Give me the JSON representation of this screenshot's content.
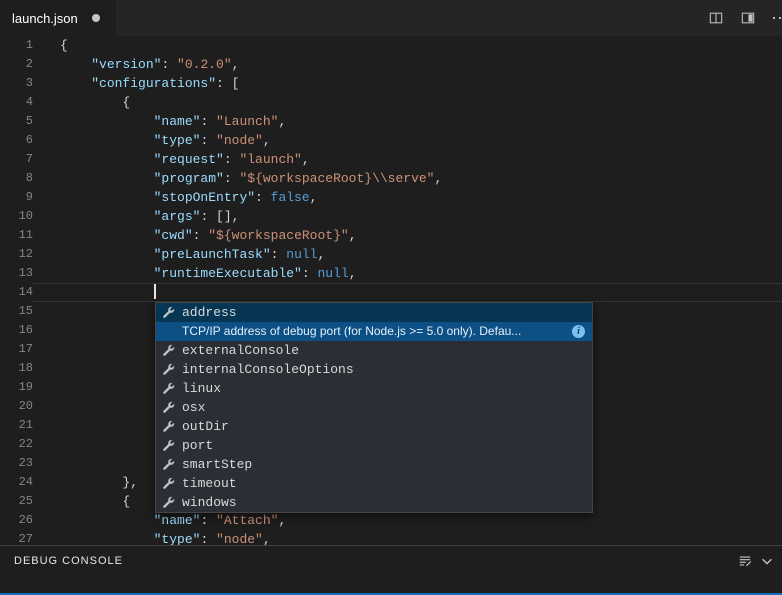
{
  "tab": {
    "title": "launch.json",
    "modified": true
  },
  "editor_actions": {
    "icons": [
      "split-editor-icon",
      "toggle-layout-icon",
      "more-actions-icon"
    ],
    "more_label": "⋯"
  },
  "colors": {
    "editor_bg": "#1e1e1e",
    "tabbar_bg": "#252526",
    "key": "#9cdcfe",
    "string": "#ce9178",
    "keyword": "#569cd6",
    "punct": "#d4d4d4",
    "line_number": "#858585",
    "suggest_bg": "#2b2f35",
    "suggest_selected_bg": "#073655",
    "suggest_docs_bg": "#0d5086",
    "accent": "#0e70c0"
  },
  "editor": {
    "lines": [
      {
        "num": 1,
        "tokens": [
          {
            "c": "p",
            "v": "{"
          }
        ]
      },
      {
        "num": 2,
        "tokens": [
          {
            "c": "p",
            "v": "    "
          },
          {
            "c": "k",
            "v": "\"version\""
          },
          {
            "c": "p",
            "v": ": "
          },
          {
            "c": "s",
            "v": "\"0.2.0\""
          },
          {
            "c": "p",
            "v": ","
          }
        ]
      },
      {
        "num": 3,
        "tokens": [
          {
            "c": "p",
            "v": "    "
          },
          {
            "c": "k",
            "v": "\"configurations\""
          },
          {
            "c": "p",
            "v": ": ["
          }
        ]
      },
      {
        "num": 4,
        "tokens": [
          {
            "c": "p",
            "v": "        {"
          }
        ]
      },
      {
        "num": 5,
        "tokens": [
          {
            "c": "p",
            "v": "            "
          },
          {
            "c": "k",
            "v": "\"name\""
          },
          {
            "c": "p",
            "v": ": "
          },
          {
            "c": "s",
            "v": "\"Launch\""
          },
          {
            "c": "p",
            "v": ","
          }
        ]
      },
      {
        "num": 6,
        "tokens": [
          {
            "c": "p",
            "v": "            "
          },
          {
            "c": "k",
            "v": "\"type\""
          },
          {
            "c": "p",
            "v": ": "
          },
          {
            "c": "s",
            "v": "\"node\""
          },
          {
            "c": "p",
            "v": ","
          }
        ]
      },
      {
        "num": 7,
        "tokens": [
          {
            "c": "p",
            "v": "            "
          },
          {
            "c": "k",
            "v": "\"request\""
          },
          {
            "c": "p",
            "v": ": "
          },
          {
            "c": "s",
            "v": "\"launch\""
          },
          {
            "c": "p",
            "v": ","
          }
        ]
      },
      {
        "num": 8,
        "tokens": [
          {
            "c": "p",
            "v": "            "
          },
          {
            "c": "k",
            "v": "\"program\""
          },
          {
            "c": "p",
            "v": ": "
          },
          {
            "c": "s",
            "v": "\"${workspaceRoot}\\\\serve\""
          },
          {
            "c": "p",
            "v": ","
          }
        ]
      },
      {
        "num": 9,
        "tokens": [
          {
            "c": "p",
            "v": "            "
          },
          {
            "c": "k",
            "v": "\"stopOnEntry\""
          },
          {
            "c": "p",
            "v": ": "
          },
          {
            "c": "b",
            "v": "false"
          },
          {
            "c": "p",
            "v": ","
          }
        ]
      },
      {
        "num": 10,
        "tokens": [
          {
            "c": "p",
            "v": "            "
          },
          {
            "c": "k",
            "v": "\"args\""
          },
          {
            "c": "p",
            "v": ": [],"
          }
        ]
      },
      {
        "num": 11,
        "tokens": [
          {
            "c": "p",
            "v": "            "
          },
          {
            "c": "k",
            "v": "\"cwd\""
          },
          {
            "c": "p",
            "v": ": "
          },
          {
            "c": "s",
            "v": "\"${workspaceRoot}\""
          },
          {
            "c": "p",
            "v": ","
          }
        ]
      },
      {
        "num": 12,
        "tokens": [
          {
            "c": "p",
            "v": "            "
          },
          {
            "c": "k",
            "v": "\"preLaunchTask\""
          },
          {
            "c": "p",
            "v": ": "
          },
          {
            "c": "b",
            "v": "null"
          },
          {
            "c": "p",
            "v": ","
          }
        ]
      },
      {
        "num": 13,
        "tokens": [
          {
            "c": "p",
            "v": "            "
          },
          {
            "c": "k",
            "v": "\"runtimeExecutable\""
          },
          {
            "c": "p",
            "v": ": "
          },
          {
            "c": "b",
            "v": "null"
          },
          {
            "c": "p",
            "v": ","
          }
        ]
      },
      {
        "num": 14,
        "current": true,
        "cursor": true,
        "tokens": [
          {
            "c": "p",
            "v": "            "
          }
        ]
      },
      {
        "num": 15,
        "tokens": []
      },
      {
        "num": 16,
        "tokens": []
      },
      {
        "num": 17,
        "tokens": []
      },
      {
        "num": 18,
        "tokens": []
      },
      {
        "num": 19,
        "tokens": []
      },
      {
        "num": 20,
        "tokens": []
      },
      {
        "num": 21,
        "tokens": []
      },
      {
        "num": 22,
        "tokens": []
      },
      {
        "num": 23,
        "tokens": []
      },
      {
        "num": 24,
        "tokens": [
          {
            "c": "p",
            "v": "        },"
          }
        ]
      },
      {
        "num": 25,
        "tokens": [
          {
            "c": "p",
            "v": "        {"
          }
        ]
      },
      {
        "num": 26,
        "tokens": [
          {
            "c": "p",
            "v": "            "
          },
          {
            "c": "k",
            "v": "\"name\""
          },
          {
            "c": "p",
            "v": ": "
          },
          {
            "c": "s",
            "v": "\"Attach\""
          },
          {
            "c": "p",
            "v": ","
          }
        ]
      },
      {
        "num": 27,
        "tokens": [
          {
            "c": "p",
            "v": "            "
          },
          {
            "c": "k",
            "v": "\"type\""
          },
          {
            "c": "p",
            "v": ": "
          },
          {
            "c": "s",
            "v": "\"node\""
          },
          {
            "c": "p",
            "v": ","
          }
        ]
      }
    ]
  },
  "suggest": {
    "kind_icon": "wrench-icon",
    "docs": "TCP/IP address of debug port (for Node.js >= 5.0 only). Defau...",
    "docs_info_icon": "info-icon",
    "items": [
      {
        "label": "address",
        "selected": true
      },
      {
        "label": "externalConsole"
      },
      {
        "label": "internalConsoleOptions"
      },
      {
        "label": "linux"
      },
      {
        "label": "osx"
      },
      {
        "label": "outDir"
      },
      {
        "label": "port"
      },
      {
        "label": "smartStep"
      },
      {
        "label": "timeout"
      },
      {
        "label": "windows"
      }
    ]
  },
  "panel": {
    "title": "DEBUG CONSOLE",
    "icons": [
      "clear-console-icon",
      "chevron-down-icon"
    ]
  }
}
